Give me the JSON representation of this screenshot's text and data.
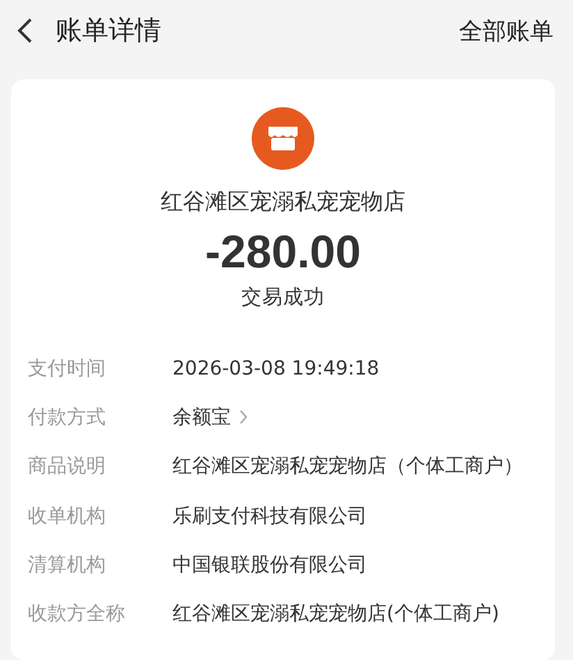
{
  "header": {
    "title": "账单详情",
    "action": "全部账单"
  },
  "summary": {
    "merchant": "红谷滩区宠溺私宠宠物店",
    "amount": "-280.00",
    "status": "交易成功"
  },
  "details": [
    {
      "label": "支付时间",
      "value": "2026-03-08 19:49:18",
      "kind": "text"
    },
    {
      "label": "付款方式",
      "value": "余额宝",
      "kind": "link"
    },
    {
      "label": "商品说明",
      "value": "红谷滩区宠溺私宠宠物店（个体工商户）",
      "kind": "text"
    },
    {
      "label": "收单机构",
      "value": "乐刷支付科技有限公司",
      "kind": "text"
    },
    {
      "label": "清算机构",
      "value": "中国银联股份有限公司",
      "kind": "text"
    },
    {
      "label": "收款方全称",
      "value": "红谷滩区宠溺私宠宠物店(个体工商户)",
      "kind": "text"
    }
  ]
}
